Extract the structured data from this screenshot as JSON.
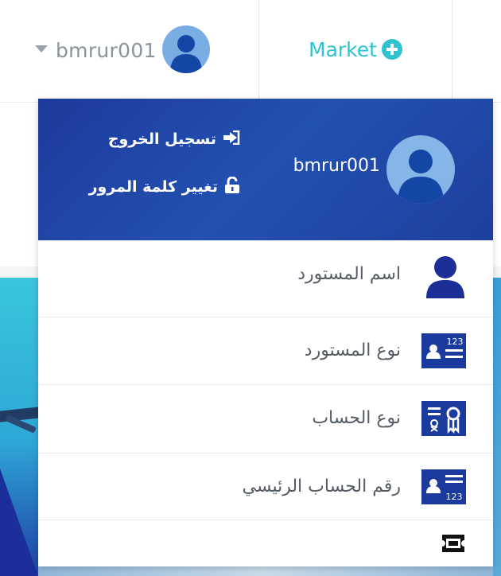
{
  "topbar": {
    "username": "bmrur001",
    "market_label": "Market",
    "icons": {
      "caret": "caret-down-icon",
      "avatar": "user-avatar-icon",
      "market": "plus-circle-icon"
    }
  },
  "dropdown": {
    "username": "bmrur001",
    "logout_label": "تسجيل الخروج",
    "change_password_label": "تغيير كلمة المرور",
    "rows": [
      {
        "label": "اسم المستورد",
        "icon": "user-icon"
      },
      {
        "label": "نوع المستورد",
        "icon": "id-card-123-icon"
      },
      {
        "label": "نوع الحساب",
        "icon": "certificate-icon"
      },
      {
        "label": "رقم الحساب الرئيسي",
        "icon": "account-number-icon"
      },
      {
        "label": "",
        "icon": "ticket-icon"
      }
    ]
  },
  "colors": {
    "header_gradient_start": "#1c3a9c",
    "header_gradient_end": "#2351b0",
    "accent_teal": "#2ec3cf",
    "icon_blue": "#1b3a9e",
    "avatar_blue": "#7aaee3"
  }
}
